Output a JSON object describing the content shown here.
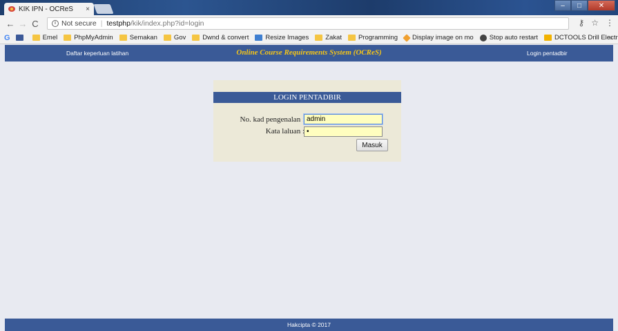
{
  "browser": {
    "tab_title": "KIK IPN - OCReS",
    "tab_close": "×",
    "win_controls": [
      "–",
      "□",
      "✕"
    ],
    "nav": {
      "back": "←",
      "forward": "→",
      "reload": "C"
    },
    "security_text": "Not secure",
    "url_host": "testphp",
    "url_path": "/kik/index.php?id=login",
    "toolbar_icons": [
      "key-icon",
      "star-icon",
      "menu-icon"
    ],
    "bookmarks": [
      {
        "label": "Emel",
        "icon": "folder-icon"
      },
      {
        "label": "PhpMyAdmin",
        "icon": "folder-icon"
      },
      {
        "label": "Semakan",
        "icon": "folder-icon"
      },
      {
        "label": "Gov",
        "icon": "folder-icon"
      },
      {
        "label": "Dwnd & convert",
        "icon": "folder-icon"
      },
      {
        "label": "Resize Images",
        "icon": "resize-icon"
      },
      {
        "label": "Zakat",
        "icon": "folder-icon"
      },
      {
        "label": "Programming",
        "icon": "folder-icon"
      },
      {
        "label": "Display image on mo",
        "icon": "web-icon"
      },
      {
        "label": "Stop auto restart",
        "icon": "settings-icon"
      },
      {
        "label": "DCTOOLS Drill Electr",
        "icon": "tool-icon"
      }
    ],
    "bookmarks_more": "»"
  },
  "header": {
    "left_link": "Daftar keperluan latihan",
    "title": "Online Course Requirements System (OCReS)",
    "right_link": "Login pentadbir"
  },
  "login": {
    "title": "LOGIN PENTADBIR",
    "id_label": "No. kad pengenalan  :",
    "id_value": "admin",
    "password_label": "Kata laluan  :",
    "password_value": "•",
    "submit_label": "Masuk"
  },
  "footer": {
    "text": "Hakcipta © 2017"
  },
  "colors": {
    "header_bg": "#3a5a97",
    "title_accent": "#f5c518",
    "login_bg": "#ece9d8",
    "input_bg": "#fffebf",
    "page_bg": "#e8eaf1"
  }
}
